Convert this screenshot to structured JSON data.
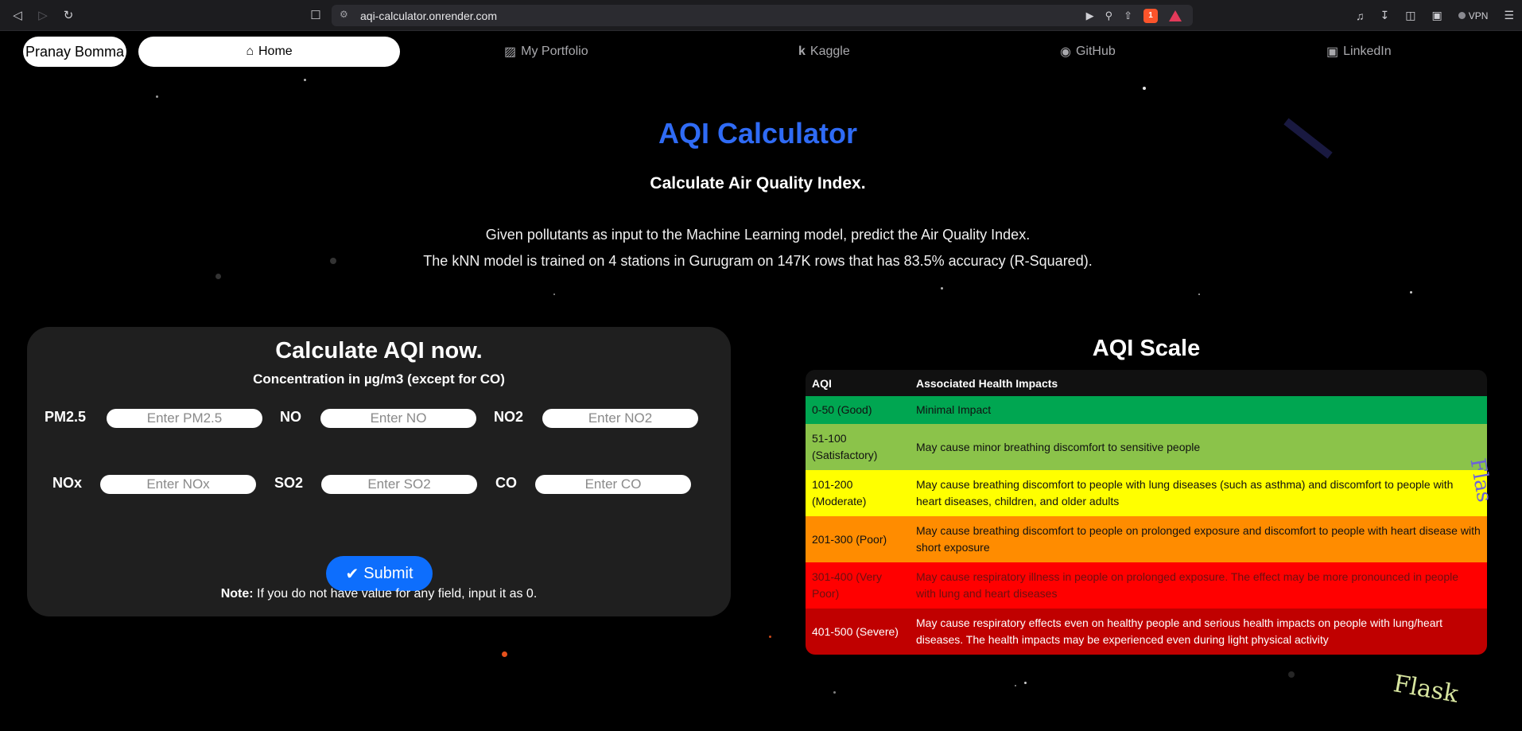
{
  "browser": {
    "url": "aqi-calculator.onrender.com",
    "brave_badge": "1",
    "vpn_label": "VPN"
  },
  "nav": {
    "brand": "Pranay Bomma",
    "home": "Home",
    "portfolio": "My Portfolio",
    "kaggle": "Kaggle",
    "github": "GitHub",
    "linkedin": "LinkedIn"
  },
  "hero": {
    "title": "AQI Calculator",
    "subtitle": "Calculate Air Quality Index.",
    "desc_line1": "Given pollutants as input to the Machine Learning model, predict the Air Quality Index.",
    "desc_line2": "The kNN model is trained on 4 stations in Gurugram on 147K rows that has 83.5% accuracy (R-Squared)."
  },
  "form": {
    "title": "Calculate AQI now.",
    "subtitle": "Concentration in µg/m3 (except for CO)",
    "fields": [
      {
        "label": "PM2.5",
        "placeholder": "Enter PM2.5"
      },
      {
        "label": "NO",
        "placeholder": "Enter NO"
      },
      {
        "label": "NO2",
        "placeholder": "Enter NO2"
      },
      {
        "label": "NOx",
        "placeholder": "Enter NOx"
      },
      {
        "label": "SO2",
        "placeholder": "Enter SO2"
      },
      {
        "label": "CO",
        "placeholder": "Enter CO"
      }
    ],
    "submit": "Submit",
    "note_bold": "Note:",
    "note_text": " If you do not have value for any field, input it as 0."
  },
  "scale": {
    "title": "AQI Scale",
    "headers": [
      "AQI",
      "Associated Health Impacts"
    ],
    "rows": [
      {
        "aqi": "0-50 (Good)",
        "impact": "Minimal Impact"
      },
      {
        "aqi": "51-100 (Satisfactory)",
        "impact": "May cause minor breathing discomfort to sensitive people"
      },
      {
        "aqi": "101-200 (Moderate)",
        "impact": "May cause breathing discomfort to people with lung diseases (such as asthma) and discomfort to people with heart diseases, children, and older adults"
      },
      {
        "aqi": "201-300 (Poor)",
        "impact": "May cause breathing discomfort to people on prolonged exposure and discomfort to people with heart disease with short exposure"
      },
      {
        "aqi": "301-400 (Very Poor)",
        "impact": "May cause respiratory illness in people on prolonged exposure. The effect may be more pronounced in people with lung and heart diseases"
      },
      {
        "aqi": "401-500 (Severe)",
        "impact": "May cause respiratory effects even on healthy people and serious health impacts on people with lung/heart diseases. The health impacts may be experienced even during light physical activity"
      }
    ],
    "colors": [
      "#00a651",
      "#8bc34a",
      "#ffff00",
      "#ff8c00",
      "#ff0000",
      "#c00000"
    ]
  },
  "decor": {
    "flask_bottom": "Flask",
    "flask_side": "Flas"
  }
}
